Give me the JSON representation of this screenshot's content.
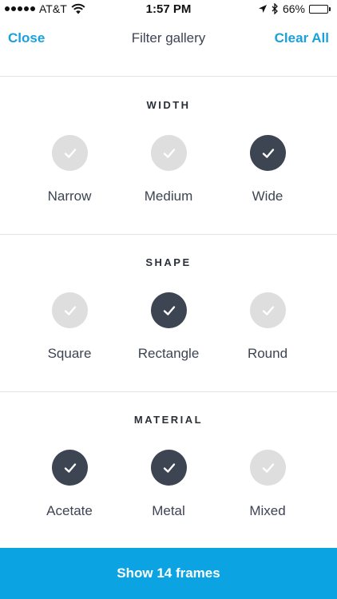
{
  "status_bar": {
    "carrier": "AT&T",
    "time": "1:57 PM",
    "battery": "66%",
    "battery_level": 0.66,
    "signal_dots": 5,
    "icons": [
      "signal-dots-icon",
      "wifi-icon",
      "location-arrow-icon",
      "bluetooth-icon",
      "battery-icon"
    ]
  },
  "nav": {
    "close_label": "Close",
    "title": "Filter gallery",
    "clear_label": "Clear All"
  },
  "sections": [
    {
      "title": "WIDTH",
      "options": [
        {
          "label": "Narrow",
          "selected": false
        },
        {
          "label": "Medium",
          "selected": false
        },
        {
          "label": "Wide",
          "selected": true
        }
      ]
    },
    {
      "title": "SHAPE",
      "options": [
        {
          "label": "Square",
          "selected": false
        },
        {
          "label": "Rectangle",
          "selected": true
        },
        {
          "label": "Round",
          "selected": false
        }
      ]
    },
    {
      "title": "MATERIAL",
      "options": [
        {
          "label": "Acetate",
          "selected": true
        },
        {
          "label": "Metal",
          "selected": true
        },
        {
          "label": "Mixed",
          "selected": false
        }
      ]
    }
  ],
  "show_button_label": "Show 14 frames",
  "colors": {
    "accent": "#1aa0dc",
    "button_bg": "#0ba3e2",
    "selected_circle": "#3d4452",
    "unselected_circle": "#dedede",
    "text": "#3d4452"
  }
}
